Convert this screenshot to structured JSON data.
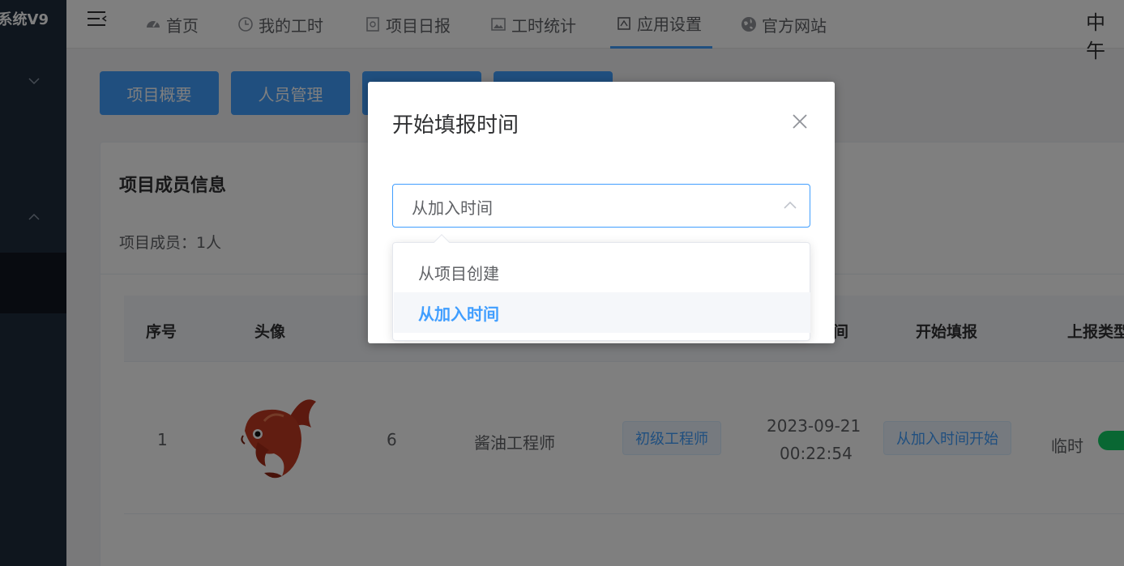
{
  "sidebar": {
    "brand": "系统V9"
  },
  "nav": {
    "items": [
      {
        "label": "首页",
        "icon": "dashboard-icon"
      },
      {
        "label": "我的工时",
        "icon": "clock-icon"
      },
      {
        "label": "项目日报",
        "icon": "report-icon"
      },
      {
        "label": "工时统计",
        "icon": "picture-icon"
      },
      {
        "label": "应用设置",
        "icon": "settings-icon"
      },
      {
        "label": "官方网站",
        "icon": "globe-icon"
      }
    ],
    "greeting": "中午"
  },
  "tabs": [
    "项目概要",
    "人员管理",
    "",
    ""
  ],
  "card": {
    "title": "项目成员信息",
    "member_count": "项目成员：1人"
  },
  "table": {
    "headers": [
      "序号",
      "头像",
      "间",
      "开始填报",
      "上报类型"
    ],
    "row": {
      "index": "1",
      "id": "6",
      "name": "酱油工程师",
      "level": "初级工程师",
      "join_date": "2023-09-21",
      "join_time": "00:22:54",
      "fill_start": "从加入时间开始",
      "report_type": "临时"
    }
  },
  "dialog": {
    "title": "开始填报时间",
    "select_value": "从加入时间",
    "options": [
      "从项目创建",
      "从加入时间"
    ],
    "selected_index": 1
  },
  "colors": {
    "primary": "#409eff",
    "sidebar": "#1f2d3d",
    "toggle_on": "#13ce66"
  }
}
